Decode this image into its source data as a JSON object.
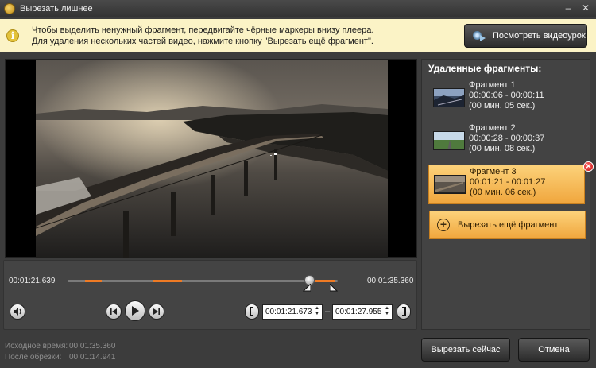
{
  "window": {
    "title": "Вырезать лишнее"
  },
  "info": {
    "line1": "Чтобы выделить ненужный фрагмент, передвигайте чёрные маркеры внизу плеера.",
    "line2": "Для удаления нескольких частей видео, нажмите кнопку \"Вырезать ещё фрагмент\".",
    "tutorial_button": "Посмотреть видеоурок"
  },
  "player": {
    "current_time": "00:01:21.639",
    "total_time": "00:01:35.360",
    "range_start": "00:01:21.673",
    "range_end": "00:01:27.955",
    "range_separator": "–"
  },
  "sidebar": {
    "title": "Удаленные фрагменты:",
    "fragments": [
      {
        "name": "Фрагмент 1",
        "range": "00:00:06 - 00:00:11",
        "duration": "(00 мин. 05 сек.)"
      },
      {
        "name": "Фрагмент 2",
        "range": "00:00:28 - 00:00:37",
        "duration": "(00 мин. 08 сек.)"
      },
      {
        "name": "Фрагмент 3",
        "range": "00:01:21 - 00:01:27",
        "duration": "(00 мин. 06 сек.)"
      }
    ],
    "add_button": "Вырезать ещё фрагмент"
  },
  "footer": {
    "original_label": "Исходное время:",
    "original_value": "00:01:35.360",
    "after_label": "После обрезки:",
    "after_value": "00:01:14.941",
    "cut_button": "Вырезать сейчас",
    "cancel_button": "Отмена"
  }
}
